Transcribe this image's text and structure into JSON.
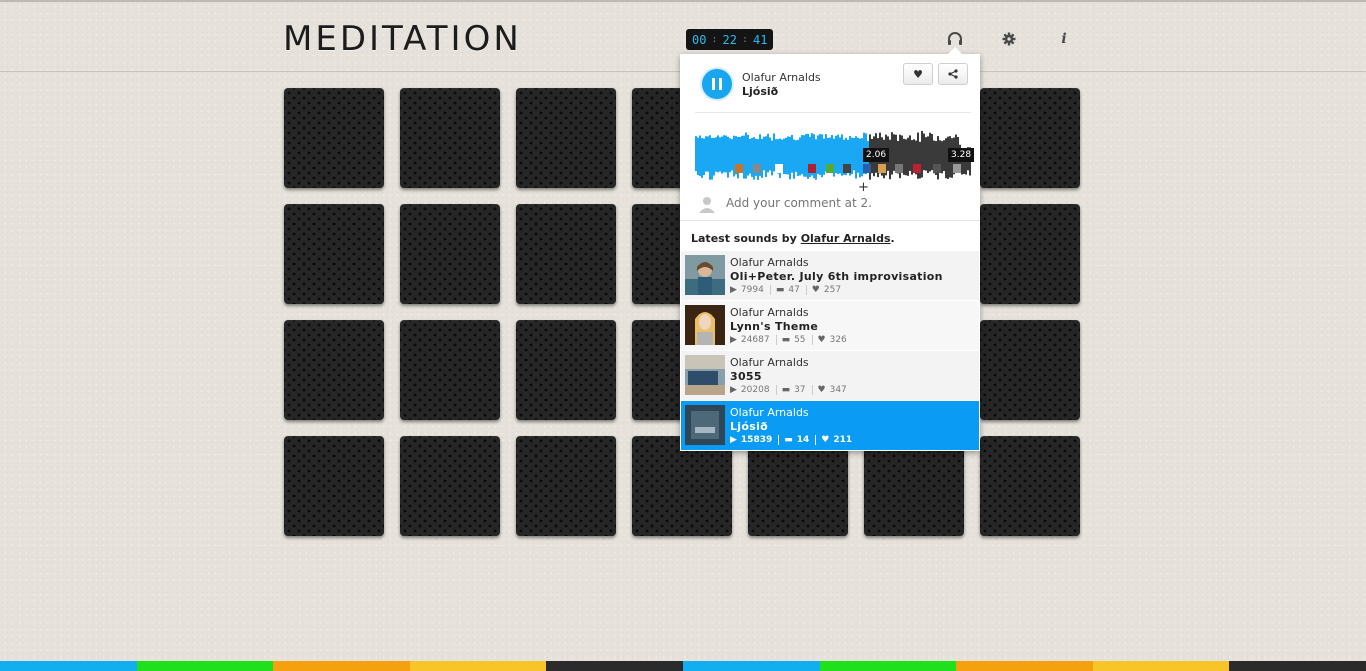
{
  "app": {
    "logo": "MEDITATION",
    "timer": {
      "hours": "00",
      "minutes": "22",
      "seconds": "41",
      "separator": ":"
    }
  },
  "header_icons": [
    "headphones-icon",
    "gear-icon",
    "info-icon"
  ],
  "player": {
    "artist": "Olafur Arnalds",
    "title": "Ljósið",
    "current_time": "2.06",
    "total_time": "3.28",
    "progress": 0.63,
    "comment_placeholder": "Add your comment at 2.",
    "add_symbol": "+"
  },
  "latest": {
    "prefix": "Latest sounds by ",
    "artist_link": "Olafur Arnalds",
    "suffix": "."
  },
  "tracks": [
    {
      "artist": "Olafur Arnalds",
      "title": "Oli+Peter. July 6th improvisation",
      "plays": "7994",
      "comments": "47",
      "likes": "257",
      "active": false
    },
    {
      "artist": "Olafur Arnalds",
      "title": "Lynn's Theme",
      "plays": "24687",
      "comments": "55",
      "likes": "326",
      "active": false
    },
    {
      "artist": "Olafur Arnalds",
      "title": "3055",
      "plays": "20208",
      "comments": "37",
      "likes": "347",
      "active": false
    },
    {
      "artist": "Olafur Arnalds",
      "title": "Ljósið",
      "plays": "15839",
      "comments": "14",
      "likes": "211",
      "active": true
    }
  ],
  "colors": {
    "accent": "#0a9cf4",
    "timer_digits": "#2fb8f0",
    "bottom_stripes": [
      "#13aef0",
      "#1fe01b",
      "#f5a10f",
      "#f7c52a",
      "#2b2b2b",
      "#13aef0",
      "#1fe01b",
      "#f5a10f",
      "#f7c52a",
      "#2b2b2b"
    ]
  }
}
